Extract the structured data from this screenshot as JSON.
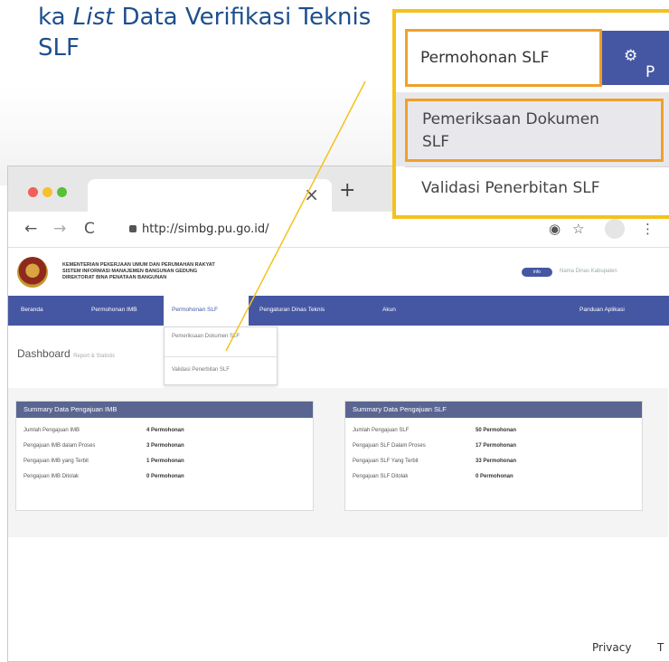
{
  "heading": {
    "prefix": "ka ",
    "italic": "List",
    "rest": " Data Verifikasi Teknis",
    "line2": "SLF"
  },
  "browser": {
    "address": "http://simbg.pu.go.id/",
    "close_glyph": "×",
    "new_tab_glyph": "+",
    "footer_privacy": "Privacy",
    "footer_cut": "T"
  },
  "site": {
    "org_line1": "KEMENTERIAN PEKERJAAN UMUM DAN PERUMAHAN RAKYAT",
    "org_line2": "SISTEM INFORMASI MANAJEMEN BANGUNAN GEDUNG",
    "org_line3": "DIREKTORAT BINA PENATAAN BANGUNAN",
    "user_pill": "info",
    "user_name": "Nama Dinas Kabupaten"
  },
  "nav": {
    "beranda": "Beranda",
    "permohonan_imb": "Permohonan IMB",
    "permohonan_slf": "Permohonan SLF",
    "pengaturan": "Pengaturan Dinas Teknis",
    "akun": "Akun",
    "panduan": "Panduan Aplikasi"
  },
  "dropdown": {
    "item1": "Pemeriksaan Dokumen SLF",
    "item2": "Validasi Penerbitan SLF"
  },
  "dashboard": {
    "title": "Dashboard",
    "subtitle": "Report & Statistic"
  },
  "imb_card": {
    "title": "Summary Data Pengajuan IMB",
    "rows": [
      {
        "label": "Jumlah Pengajuan IMB",
        "value": "4 Permohonan"
      },
      {
        "label": "Pengajuan IMB dalam Proses",
        "value": "3 Permohonan"
      },
      {
        "label": "Pengajuan IMB yang Terbit",
        "value": "1 Permohonan"
      },
      {
        "label": "Pengajuan IMB Ditolak",
        "value": "0 Permohonan"
      }
    ]
  },
  "slf_card": {
    "title": "Summary Data Pengajuan SLF",
    "rows": [
      {
        "label": "Jumlah Pengajuan SLF",
        "value": "50 Permohonan"
      },
      {
        "label": "Pengajuan SLF Dalam Proses",
        "value": "17 Permohonan"
      },
      {
        "label": "Pengajuan SLF Yang Terbit",
        "value": "33 Permohonan"
      },
      {
        "label": "Pengajuan SLF Ditolak",
        "value": "0 Permohonan"
      }
    ]
  },
  "callout": {
    "tab_label": "Permohonan SLF",
    "next_label": "P",
    "item1": "Pemeriksaan Dokumen SLF",
    "item2": "Validasi Penerbitan SLF"
  },
  "colors": {
    "heading": "#1d4f8c",
    "navbar": "#4557a3",
    "highlight": "#f5c11c",
    "card_header": "#5a6691"
  }
}
